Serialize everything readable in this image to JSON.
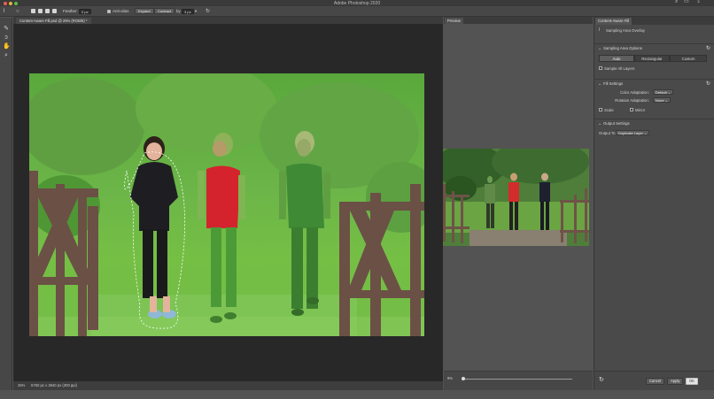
{
  "window": {
    "title": "Adobe Photoshop 2020"
  },
  "options_bar": {
    "feather_label": "Feather:",
    "feather_value": "0 px",
    "antialias_label": "Anti-alias",
    "antialias_checked": true,
    "expand_label": "Expand",
    "contract_label": "Contract",
    "by_label": "by",
    "by_value": "3 px"
  },
  "document": {
    "tab_label": "Content-Aware Fill.psd @ 25% (RGB/8) *",
    "zoom": "25%",
    "info": "5760 px x 3840 px (300 ppi)"
  },
  "preview": {
    "tab_label": "Preview",
    "zoom": "9%",
    "zoom_fraction": 0.0
  },
  "panel": {
    "tab_label": "Content-Aware Fill",
    "sampling_overlay_label": "Sampling Area Overlay",
    "sampling_options": {
      "title": "Sampling Area Options",
      "modes": [
        "Auto",
        "Rectangular",
        "Custom"
      ],
      "active_mode": "Auto",
      "sample_all_layers": "Sample All Layers"
    },
    "fill_settings": {
      "title": "Fill Settings",
      "color_adaptation_label": "Color Adaptation:",
      "color_adaptation_value": "Default",
      "rotation_adaptation_label": "Rotation Adaptation:",
      "rotation_adaptation_value": "None",
      "scale_label": "Scale",
      "mirror_label": "Mirror"
    },
    "output_settings": {
      "title": "Output Settings",
      "output_to_label": "Output To:",
      "output_to_value": "Duplicate Layer"
    },
    "footer": {
      "cancel": "Cancel",
      "apply": "Apply",
      "ok": "OK"
    }
  },
  "colors": {
    "overlay_green": "#6fc24a",
    "shirt_red": "#d4232d",
    "accent_bg": "#535353"
  }
}
